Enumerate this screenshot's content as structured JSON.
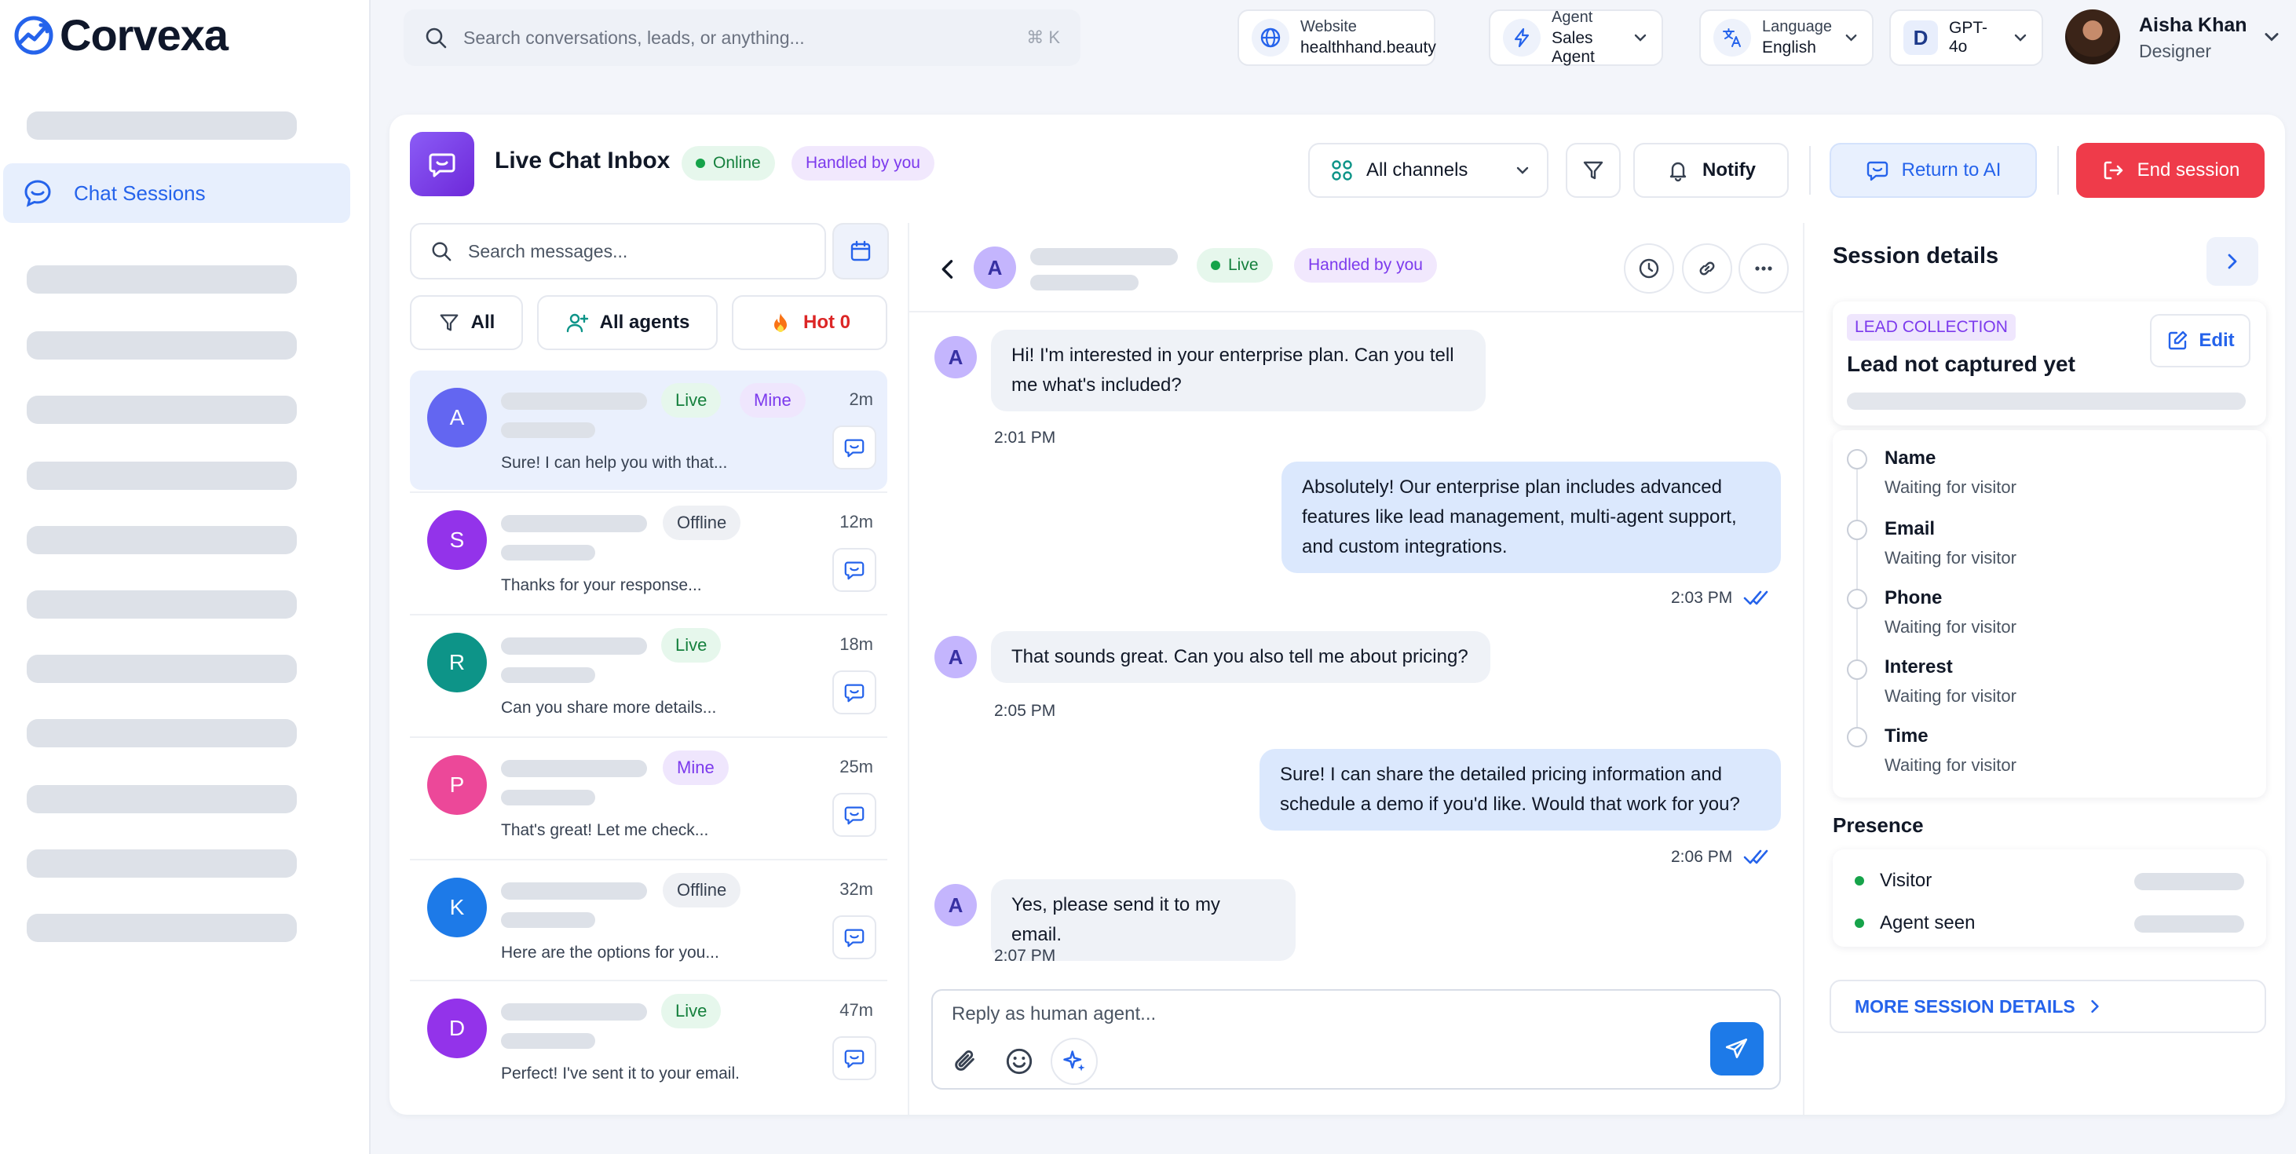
{
  "brand": {
    "name": "Corvexa"
  },
  "sidebar": {
    "active_item": "Chat Sessions"
  },
  "topbar": {
    "search_placeholder": "Search conversations, leads, or anything...",
    "search_shortcut": "⌘ K",
    "website": {
      "label": "Website",
      "value": "healthhand.beauty"
    },
    "agent": {
      "label": "Agent",
      "value": "Sales Agent"
    },
    "language": {
      "label": "Language",
      "value": "English"
    },
    "model": {
      "badge": "D",
      "value": "GPT-4o"
    },
    "user": {
      "name": "Aisha Khan",
      "role": "Designer"
    }
  },
  "inbox": {
    "title": "Live Chat Inbox",
    "status": "Online",
    "handled": "Handled by you",
    "channels": "All channels",
    "notify": "Notify",
    "return_ai": "Return to AI",
    "end_session": "End session"
  },
  "list": {
    "search_placeholder": "Search messages...",
    "filter_all": "All",
    "filter_agents": "All agents",
    "filter_hot": "Hot 0",
    "items": [
      {
        "initial": "A",
        "badges": [
          "Live",
          "Mine"
        ],
        "time": "2m",
        "preview": "Sure! I can help you with that...",
        "color": "#6366f1"
      },
      {
        "initial": "S",
        "badges": [
          "Offline"
        ],
        "time": "12m",
        "preview": "Thanks for your response...",
        "color": "#9333ea"
      },
      {
        "initial": "R",
        "badges": [
          "Live"
        ],
        "time": "18m",
        "preview": "Can you share more details...",
        "color": "#0d9488"
      },
      {
        "initial": "P",
        "badges": [
          "Mine"
        ],
        "time": "25m",
        "preview": "That's great! Let me check...",
        "color": "#ec4899"
      },
      {
        "initial": "K",
        "badges": [
          "Offline"
        ],
        "time": "32m",
        "preview": "Here are the options for you...",
        "color": "#1d7ae8"
      },
      {
        "initial": "D",
        "badges": [
          "Live"
        ],
        "time": "47m",
        "preview": "Perfect! I've sent it to your email.",
        "color": "#9333ea"
      }
    ]
  },
  "chat": {
    "contact_initial": "A",
    "status": "Live",
    "handled": "Handled by you",
    "messages": [
      {
        "dir": "in",
        "text": "Hi! I'm interested in your enterprise plan. Can you tell me what's included?",
        "time": "2:01 PM"
      },
      {
        "dir": "out",
        "text": "Absolutely! Our enterprise plan includes advanced features like lead management, multi-agent support, and custom integrations.",
        "time": "2:03 PM"
      },
      {
        "dir": "in",
        "text": "That sounds great. Can you also tell me about pricing?",
        "time": "2:05 PM"
      },
      {
        "dir": "out",
        "text": "Sure! I can share the detailed pricing information and schedule a demo if you'd like. Would that work for you?",
        "time": "2:06 PM"
      },
      {
        "dir": "in",
        "text": "Yes, please send it to my email.",
        "time": "2:07 PM"
      }
    ],
    "reply_placeholder": "Reply as human agent..."
  },
  "details": {
    "title": "Session details",
    "lead_tag": "LEAD COLLECTION",
    "lead_title": "Lead not captured yet",
    "edit": "Edit",
    "fields": [
      {
        "name": "Name",
        "status": "Waiting for visitor"
      },
      {
        "name": "Email",
        "status": "Waiting for visitor"
      },
      {
        "name": "Phone",
        "status": "Waiting for visitor"
      },
      {
        "name": "Interest",
        "status": "Waiting for visitor"
      },
      {
        "name": "Time",
        "status": "Waiting for visitor"
      }
    ],
    "presence_title": "Presence",
    "presence": [
      {
        "label": "Visitor"
      },
      {
        "label": "Agent seen"
      }
    ],
    "more": "MORE SESSION DETAILS"
  },
  "colors": {
    "accent": "#2563eb",
    "danger": "#ef3b4a",
    "live_green": "#15803d",
    "mine_purple": "#7c3aed"
  }
}
